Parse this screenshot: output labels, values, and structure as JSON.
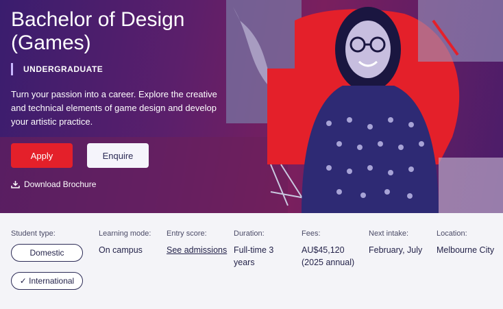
{
  "hero": {
    "title": "Bachelor of Design (Games)",
    "level": "UNDERGRADUATE",
    "description": "Turn your passion into a career. Explore the creative and technical elements of game design and develop your artistic practice.",
    "apply_label": "Apply",
    "enquire_label": "Enquire",
    "download_label": "Download Brochure"
  },
  "info": {
    "student_type": {
      "label": "Student type:",
      "options": [
        "Domestic",
        "International"
      ],
      "selected": "International"
    },
    "learning_mode": {
      "label": "Learning mode:",
      "value": "On campus"
    },
    "entry_score": {
      "label": "Entry score:",
      "value": "See admissions"
    },
    "duration": {
      "label": "Duration:",
      "value": "Full-time 3 years"
    },
    "fees": {
      "label": "Fees:",
      "value": "AU$45,120 (2025 annual)"
    },
    "next_intake": {
      "label": "Next intake:",
      "value": "February, July"
    },
    "location": {
      "label": "Location:",
      "value": "Melbourne City"
    }
  },
  "colors": {
    "accent_red": "#e4202a",
    "hero_purple": "#3a1d6e",
    "text_dark": "#24234a"
  }
}
